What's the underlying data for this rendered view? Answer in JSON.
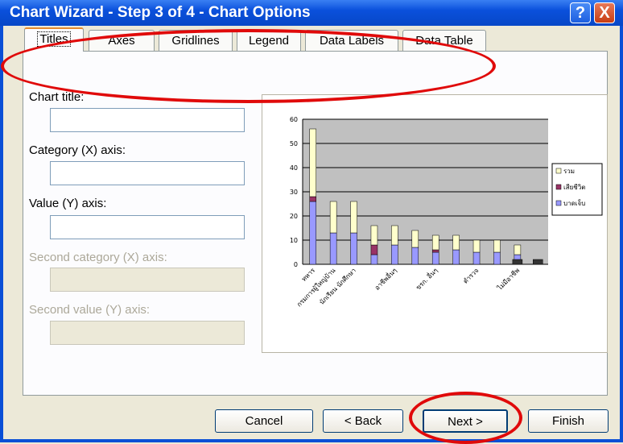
{
  "window": {
    "title": "Chart Wizard - Step 3 of 4 - Chart Options"
  },
  "titlebar": {
    "help_glyph": "?",
    "close_glyph": "X"
  },
  "tabs": [
    {
      "label": "Titles",
      "active": true
    },
    {
      "label": "Axes",
      "active": false
    },
    {
      "label": "Gridlines",
      "active": false
    },
    {
      "label": "Legend",
      "active": false
    },
    {
      "label": "Data Labels",
      "active": false
    },
    {
      "label": "Data Table",
      "active": false
    }
  ],
  "fields": {
    "chart_title": {
      "label": "Chart title:",
      "value": ""
    },
    "category_x": {
      "label": "Category (X) axis:",
      "value": ""
    },
    "value_y": {
      "label": "Value (Y) axis:",
      "value": ""
    },
    "second_category_x": {
      "label": "Second category (X) axis:",
      "value": "",
      "disabled": true
    },
    "second_value_y": {
      "label": "Second value (Y) axis:",
      "value": "",
      "disabled": true
    }
  },
  "buttons": {
    "cancel": "Cancel",
    "back": "< Back",
    "next": "Next >",
    "finish": "Finish"
  },
  "colors": {
    "series_bottom": "#9999ff",
    "series_middle": "#993366",
    "series_top": "#ffffcc",
    "plot_area": "#c0c0c0",
    "annotation": "#e00a0a"
  },
  "chart_data": {
    "type": "bar",
    "stacked": true,
    "ylim": [
      0,
      60
    ],
    "yticks": [
      0,
      10,
      20,
      30,
      40,
      50,
      60
    ],
    "grid": true,
    "legend_position": "right",
    "categories": [
      "ทหาร",
      "กรมการผู้ใหญ่บ้าน",
      "นักเรียน นักศึกษา",
      "",
      "อาชีพอื่นๆ",
      "",
      "ขรก. อื่นๆ",
      "",
      "ตำรวจ",
      "",
      "ไม่มีอาชีพ",
      ""
    ],
    "series": [
      {
        "name": "บาดเจ็บ",
        "color": "#9999ff",
        "values": [
          26,
          13,
          13,
          4,
          8,
          7,
          5,
          6,
          5,
          5,
          4,
          0
        ]
      },
      {
        "name": "เสียชีวิต",
        "color": "#993366",
        "values": [
          2,
          0,
          0,
          4,
          0,
          0,
          1,
          0,
          0,
          0,
          0,
          0
        ]
      },
      {
        "name": "รวม",
        "color": "#ffffcc",
        "values": [
          28,
          13,
          13,
          8,
          8,
          7,
          6,
          6,
          5,
          5,
          4,
          0
        ]
      }
    ],
    "extra_dark_bars": [
      0,
      0,
      0,
      0,
      0,
      0,
      0,
      0,
      0,
      0,
      2,
      2
    ]
  }
}
